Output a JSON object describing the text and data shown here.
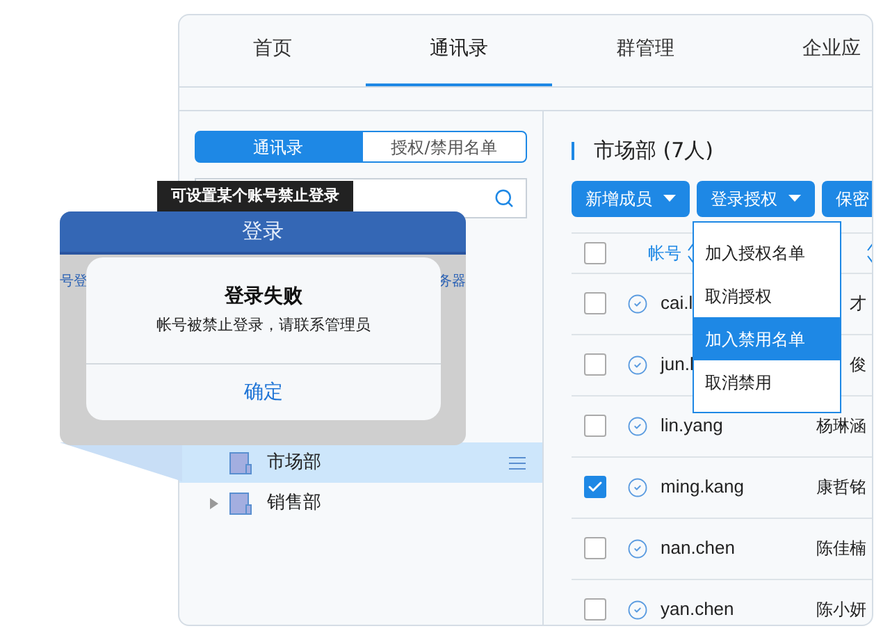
{
  "tabs": [
    {
      "label": "首页",
      "selected": false
    },
    {
      "label": "通讯录",
      "selected": true
    },
    {
      "label": "群管理",
      "selected": false
    },
    {
      "label": "企业应",
      "selected": false
    }
  ],
  "sidebar": {
    "segments": [
      {
        "label": "通讯录",
        "selected": true
      },
      {
        "label": "授权/禁用名单",
        "selected": false
      }
    ],
    "tree": [
      {
        "label": "市场部",
        "selected": true,
        "expandable": false
      },
      {
        "label": "销售部",
        "selected": false,
        "expandable": true
      }
    ]
  },
  "panel": {
    "title": "市场部 (7人)",
    "buttons": [
      {
        "label": "新增成员",
        "kind": "dropdown"
      },
      {
        "label": "登录授权",
        "kind": "dropdown"
      },
      {
        "label": "保密",
        "kind": "plain"
      }
    ],
    "table": {
      "select_all_checked": false,
      "columns": [
        "帐号"
      ],
      "rows": [
        {
          "account": "cai.l",
          "name": "才",
          "checked": false
        },
        {
          "account": "jun.l",
          "name": "俊",
          "checked": false
        },
        {
          "account": "lin.yang",
          "name": "杨琳涵",
          "checked": false
        },
        {
          "account": "ming.kang",
          "name": "康哲铭",
          "checked": true
        },
        {
          "account": "nan.chen",
          "name": "陈佳楠",
          "checked": false
        },
        {
          "account": "yan.chen",
          "name": "陈小妍",
          "checked": false
        }
      ]
    }
  },
  "dropdown": {
    "items": [
      {
        "label": "加入授权名单",
        "selected": false
      },
      {
        "label": "取消授权",
        "selected": false
      },
      {
        "label": "加入禁用名单",
        "selected": true
      },
      {
        "label": "取消禁用",
        "selected": false
      }
    ]
  },
  "tooltip": "可设置某个账号禁止登录",
  "phone": {
    "title": "登录",
    "behind_left": "号登",
    "behind_right": "务器",
    "alert": {
      "title": "登录失败",
      "message": "帐号被禁止登录，请联系管理员",
      "button": "确定"
    }
  }
}
